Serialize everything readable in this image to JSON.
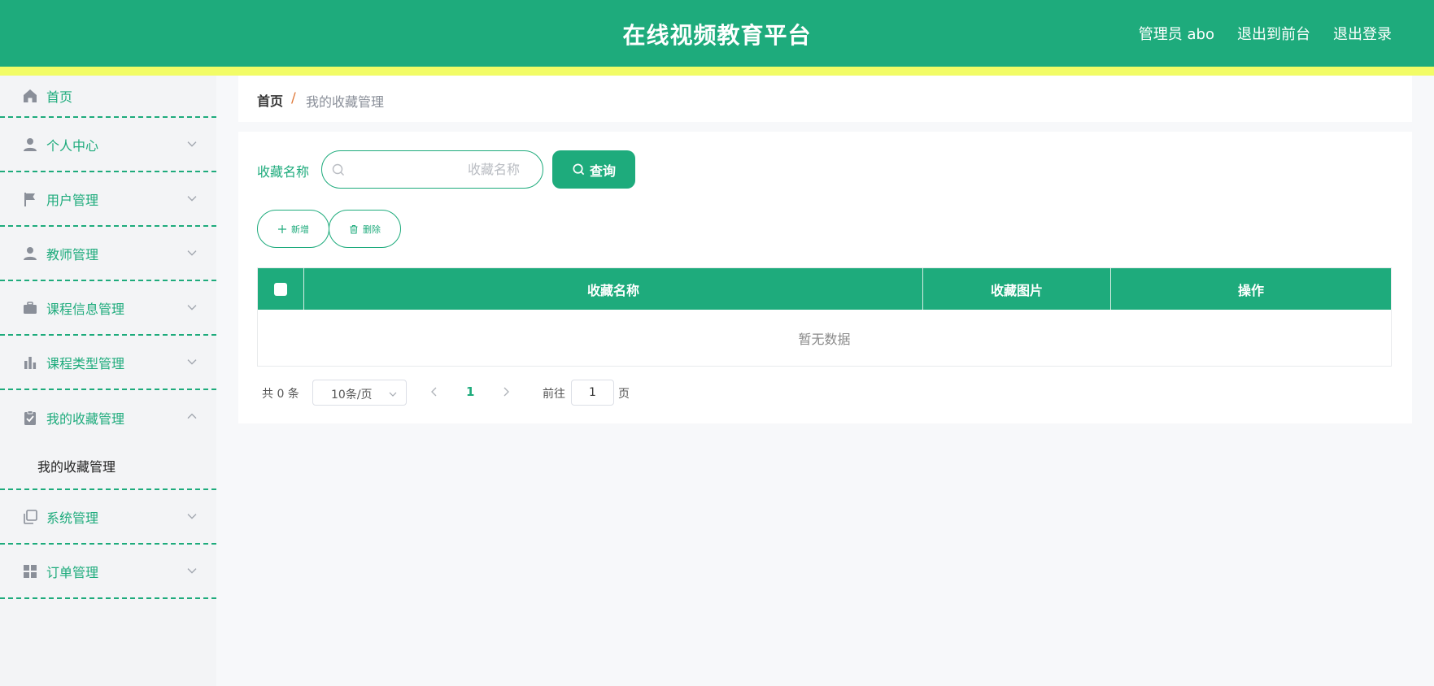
{
  "header": {
    "title": "在线视频教育平台",
    "links": [
      "管理员 abo",
      "退出到前台",
      "退出登录"
    ]
  },
  "sidebar": {
    "items": [
      {
        "label": "首页",
        "icon": "home-icon"
      },
      {
        "label": "个人中心",
        "icon": "user-icon"
      },
      {
        "label": "用户管理",
        "icon": "flag-icon"
      },
      {
        "label": "教师管理",
        "icon": "teacher-icon"
      },
      {
        "label": "课程信息管理",
        "icon": "briefcase-icon"
      },
      {
        "label": "课程类型管理",
        "icon": "bar-chart-icon"
      },
      {
        "label": "我的收藏管理",
        "icon": "clipboard-icon",
        "expanded": true,
        "children": [
          "我的收藏管理"
        ]
      },
      {
        "label": "系统管理",
        "icon": "copy-icon"
      },
      {
        "label": "订单管理",
        "icon": "grid-icon"
      }
    ]
  },
  "breadcrumb": {
    "home": "首页",
    "separator": "/",
    "current": "我的收藏管理"
  },
  "search": {
    "label": "收藏名称",
    "placeholder": "收藏名称",
    "value": "",
    "button": "查询"
  },
  "toolbar": {
    "add": "新增",
    "delete": "删除"
  },
  "table": {
    "columns": [
      "收藏名称",
      "收藏图片",
      "操作"
    ],
    "rows": [],
    "empty_text": "暂无数据"
  },
  "pagination": {
    "total_text": "共 0 条",
    "page_size": "10条/页",
    "current_page": "1",
    "goto_label": "前往",
    "goto_value": "1",
    "goto_unit": "页"
  },
  "colors": {
    "primary": "#1eab7c",
    "stripe": "#f2fc66",
    "breadcrumb_separator": "#e07b3c"
  }
}
